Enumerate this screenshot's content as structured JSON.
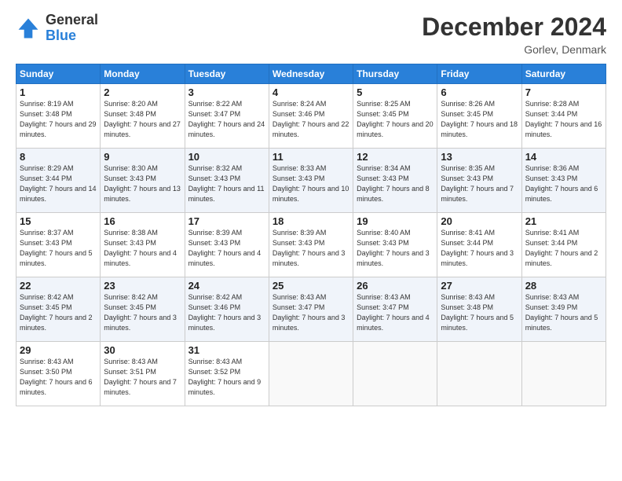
{
  "header": {
    "logo_general": "General",
    "logo_blue": "Blue",
    "month_title": "December 2024",
    "location": "Gorlev, Denmark"
  },
  "weekdays": [
    "Sunday",
    "Monday",
    "Tuesday",
    "Wednesday",
    "Thursday",
    "Friday",
    "Saturday"
  ],
  "weeks": [
    [
      {
        "day": "1",
        "sunrise": "8:19 AM",
        "sunset": "3:48 PM",
        "daylight": "7 hours and 29 minutes."
      },
      {
        "day": "2",
        "sunrise": "8:20 AM",
        "sunset": "3:48 PM",
        "daylight": "7 hours and 27 minutes."
      },
      {
        "day": "3",
        "sunrise": "8:22 AM",
        "sunset": "3:47 PM",
        "daylight": "7 hours and 24 minutes."
      },
      {
        "day": "4",
        "sunrise": "8:24 AM",
        "sunset": "3:46 PM",
        "daylight": "7 hours and 22 minutes."
      },
      {
        "day": "5",
        "sunrise": "8:25 AM",
        "sunset": "3:45 PM",
        "daylight": "7 hours and 20 minutes."
      },
      {
        "day": "6",
        "sunrise": "8:26 AM",
        "sunset": "3:45 PM",
        "daylight": "7 hours and 18 minutes."
      },
      {
        "day": "7",
        "sunrise": "8:28 AM",
        "sunset": "3:44 PM",
        "daylight": "7 hours and 16 minutes."
      }
    ],
    [
      {
        "day": "8",
        "sunrise": "8:29 AM",
        "sunset": "3:44 PM",
        "daylight": "7 hours and 14 minutes."
      },
      {
        "day": "9",
        "sunrise": "8:30 AM",
        "sunset": "3:43 PM",
        "daylight": "7 hours and 13 minutes."
      },
      {
        "day": "10",
        "sunrise": "8:32 AM",
        "sunset": "3:43 PM",
        "daylight": "7 hours and 11 minutes."
      },
      {
        "day": "11",
        "sunrise": "8:33 AM",
        "sunset": "3:43 PM",
        "daylight": "7 hours and 10 minutes."
      },
      {
        "day": "12",
        "sunrise": "8:34 AM",
        "sunset": "3:43 PM",
        "daylight": "7 hours and 8 minutes."
      },
      {
        "day": "13",
        "sunrise": "8:35 AM",
        "sunset": "3:43 PM",
        "daylight": "7 hours and 7 minutes."
      },
      {
        "day": "14",
        "sunrise": "8:36 AM",
        "sunset": "3:43 PM",
        "daylight": "7 hours and 6 minutes."
      }
    ],
    [
      {
        "day": "15",
        "sunrise": "8:37 AM",
        "sunset": "3:43 PM",
        "daylight": "7 hours and 5 minutes."
      },
      {
        "day": "16",
        "sunrise": "8:38 AM",
        "sunset": "3:43 PM",
        "daylight": "7 hours and 4 minutes."
      },
      {
        "day": "17",
        "sunrise": "8:39 AM",
        "sunset": "3:43 PM",
        "daylight": "7 hours and 4 minutes."
      },
      {
        "day": "18",
        "sunrise": "8:39 AM",
        "sunset": "3:43 PM",
        "daylight": "7 hours and 3 minutes."
      },
      {
        "day": "19",
        "sunrise": "8:40 AM",
        "sunset": "3:43 PM",
        "daylight": "7 hours and 3 minutes."
      },
      {
        "day": "20",
        "sunrise": "8:41 AM",
        "sunset": "3:44 PM",
        "daylight": "7 hours and 3 minutes."
      },
      {
        "day": "21",
        "sunrise": "8:41 AM",
        "sunset": "3:44 PM",
        "daylight": "7 hours and 2 minutes."
      }
    ],
    [
      {
        "day": "22",
        "sunrise": "8:42 AM",
        "sunset": "3:45 PM",
        "daylight": "7 hours and 2 minutes."
      },
      {
        "day": "23",
        "sunrise": "8:42 AM",
        "sunset": "3:45 PM",
        "daylight": "7 hours and 3 minutes."
      },
      {
        "day": "24",
        "sunrise": "8:42 AM",
        "sunset": "3:46 PM",
        "daylight": "7 hours and 3 minutes."
      },
      {
        "day": "25",
        "sunrise": "8:43 AM",
        "sunset": "3:47 PM",
        "daylight": "7 hours and 3 minutes."
      },
      {
        "day": "26",
        "sunrise": "8:43 AM",
        "sunset": "3:47 PM",
        "daylight": "7 hours and 4 minutes."
      },
      {
        "day": "27",
        "sunrise": "8:43 AM",
        "sunset": "3:48 PM",
        "daylight": "7 hours and 5 minutes."
      },
      {
        "day": "28",
        "sunrise": "8:43 AM",
        "sunset": "3:49 PM",
        "daylight": "7 hours and 5 minutes."
      }
    ],
    [
      {
        "day": "29",
        "sunrise": "8:43 AM",
        "sunset": "3:50 PM",
        "daylight": "7 hours and 6 minutes."
      },
      {
        "day": "30",
        "sunrise": "8:43 AM",
        "sunset": "3:51 PM",
        "daylight": "7 hours and 7 minutes."
      },
      {
        "day": "31",
        "sunrise": "8:43 AM",
        "sunset": "3:52 PM",
        "daylight": "7 hours and 9 minutes."
      },
      null,
      null,
      null,
      null
    ]
  ]
}
